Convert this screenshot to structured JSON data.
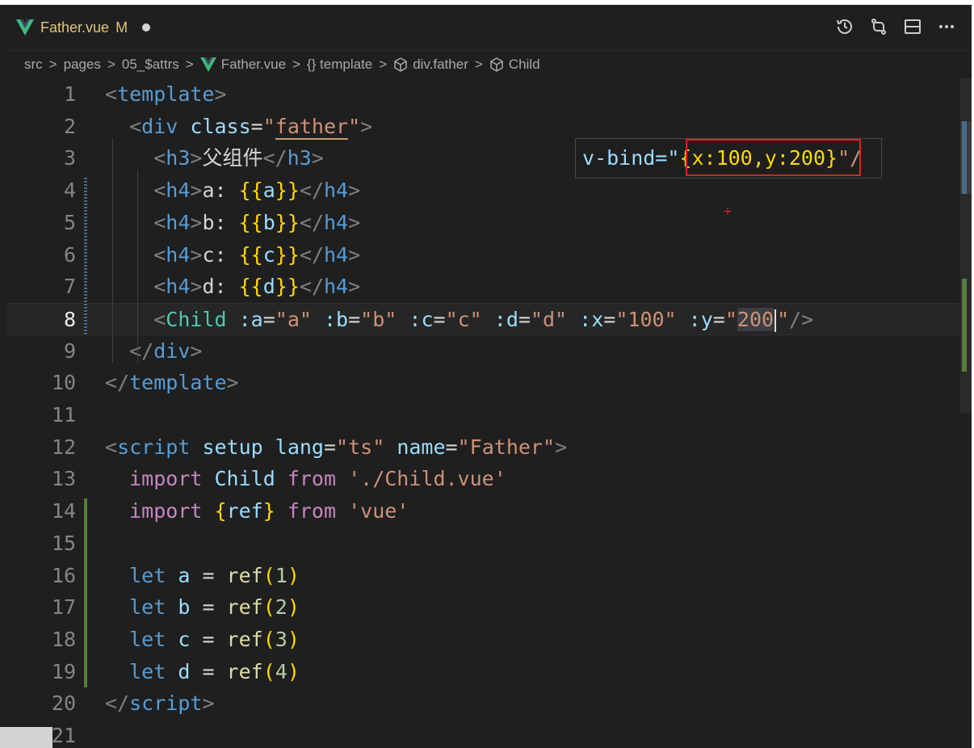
{
  "tab": {
    "title": "Father.vue",
    "status": "M"
  },
  "breadcrumb": [
    "src",
    "pages",
    "05_$attrs",
    "Father.vue",
    "{} template",
    "div.father",
    "Child"
  ],
  "hover": {
    "prefix": "v-bind=\"",
    "value": "{x:100,y:200}",
    "suffix": "\"/"
  },
  "lines": [
    {
      "n": "1",
      "tokens": [
        [
          "punc",
          "<"
        ],
        [
          "tag",
          "template"
        ],
        [
          "punc",
          ">"
        ]
      ]
    },
    {
      "n": "2",
      "tokens": [
        [
          "text",
          "  "
        ],
        [
          "punc",
          "<"
        ],
        [
          "tag",
          "div"
        ],
        [
          "text",
          " "
        ],
        [
          "attr",
          "class"
        ],
        [
          "text",
          "="
        ],
        [
          "str",
          "\""
        ],
        [
          "str",
          "father"
        ],
        [
          "str",
          "\""
        ],
        [
          "punc",
          ">"
        ]
      ]
    },
    {
      "n": "3",
      "tokens": [
        [
          "text",
          "    "
        ],
        [
          "punc",
          "<"
        ],
        [
          "tag",
          "h3"
        ],
        [
          "punc",
          ">"
        ],
        [
          "text",
          "父组件"
        ],
        [
          "punc",
          "</"
        ],
        [
          "tag",
          "h3"
        ],
        [
          "punc",
          ">"
        ]
      ]
    },
    {
      "n": "4",
      "tokens": [
        [
          "text",
          "    "
        ],
        [
          "punc",
          "<"
        ],
        [
          "tag",
          "h4"
        ],
        [
          "punc",
          ">"
        ],
        [
          "text",
          "a: "
        ],
        [
          "brace",
          "{{"
        ],
        [
          "var",
          "a"
        ],
        [
          "brace",
          "}}"
        ],
        [
          "punc",
          "</"
        ],
        [
          "tag",
          "h4"
        ],
        [
          "punc",
          ">"
        ]
      ]
    },
    {
      "n": "5",
      "tokens": [
        [
          "text",
          "    "
        ],
        [
          "punc",
          "<"
        ],
        [
          "tag",
          "h4"
        ],
        [
          "punc",
          ">"
        ],
        [
          "text",
          "b: "
        ],
        [
          "brace",
          "{{"
        ],
        [
          "var",
          "b"
        ],
        [
          "brace",
          "}}"
        ],
        [
          "punc",
          "</"
        ],
        [
          "tag",
          "h4"
        ],
        [
          "punc",
          ">"
        ]
      ]
    },
    {
      "n": "6",
      "tokens": [
        [
          "text",
          "    "
        ],
        [
          "punc",
          "<"
        ],
        [
          "tag",
          "h4"
        ],
        [
          "punc",
          ">"
        ],
        [
          "text",
          "c: "
        ],
        [
          "brace",
          "{{"
        ],
        [
          "var",
          "c"
        ],
        [
          "brace",
          "}}"
        ],
        [
          "punc",
          "</"
        ],
        [
          "tag",
          "h4"
        ],
        [
          "punc",
          ">"
        ]
      ]
    },
    {
      "n": "7",
      "tokens": [
        [
          "text",
          "    "
        ],
        [
          "punc",
          "<"
        ],
        [
          "tag",
          "h4"
        ],
        [
          "punc",
          ">"
        ],
        [
          "text",
          "d: "
        ],
        [
          "brace",
          "{{"
        ],
        [
          "var",
          "d"
        ],
        [
          "brace",
          "}}"
        ],
        [
          "punc",
          "</"
        ],
        [
          "tag",
          "h4"
        ],
        [
          "punc",
          ">"
        ]
      ]
    },
    {
      "n": "8",
      "tokens": [
        [
          "text",
          "    "
        ],
        [
          "punc",
          "<"
        ],
        [
          "comp",
          "Child"
        ],
        [
          "text",
          " "
        ],
        [
          "attr",
          ":a"
        ],
        [
          "text",
          "="
        ],
        [
          "str",
          "\"a\""
        ],
        [
          "text",
          " "
        ],
        [
          "attr",
          ":b"
        ],
        [
          "text",
          "="
        ],
        [
          "str",
          "\"b\""
        ],
        [
          "text",
          " "
        ],
        [
          "attr",
          ":c"
        ],
        [
          "text",
          "="
        ],
        [
          "str",
          "\"c\""
        ],
        [
          "text",
          " "
        ],
        [
          "attr",
          ":d"
        ],
        [
          "text",
          "="
        ],
        [
          "str",
          "\"d\""
        ],
        [
          "text",
          " "
        ],
        [
          "attr",
          ":x"
        ],
        [
          "text",
          "="
        ],
        [
          "str",
          "\"100\""
        ],
        [
          "text",
          " "
        ],
        [
          "attr",
          ":y"
        ],
        [
          "text",
          "="
        ],
        [
          "str",
          "\""
        ],
        [
          "sel",
          "200"
        ],
        [
          "cursor",
          ""
        ],
        [
          "str",
          "\""
        ],
        [
          "punc",
          "/>"
        ]
      ]
    },
    {
      "n": "9",
      "tokens": [
        [
          "text",
          "  "
        ],
        [
          "punc",
          "</"
        ],
        [
          "tag",
          "div"
        ],
        [
          "punc",
          ">"
        ]
      ]
    },
    {
      "n": "10",
      "tokens": [
        [
          "punc",
          "</"
        ],
        [
          "tag",
          "template"
        ],
        [
          "punc",
          ">"
        ]
      ]
    },
    {
      "n": "11",
      "tokens": []
    },
    {
      "n": "12",
      "tokens": [
        [
          "punc",
          "<"
        ],
        [
          "tag",
          "script"
        ],
        [
          "text",
          " "
        ],
        [
          "attr",
          "setup"
        ],
        [
          "text",
          " "
        ],
        [
          "attr",
          "lang"
        ],
        [
          "text",
          "="
        ],
        [
          "str",
          "\"ts\""
        ],
        [
          "text",
          " "
        ],
        [
          "attr",
          "name"
        ],
        [
          "text",
          "="
        ],
        [
          "str",
          "\"Father\""
        ],
        [
          "punc",
          ">"
        ]
      ]
    },
    {
      "n": "13",
      "tokens": [
        [
          "text",
          "  "
        ],
        [
          "kw",
          "import"
        ],
        [
          "text",
          " "
        ],
        [
          "var",
          "Child"
        ],
        [
          "text",
          " "
        ],
        [
          "kw",
          "from"
        ],
        [
          "text",
          " "
        ],
        [
          "str",
          "'./Child.vue'"
        ]
      ]
    },
    {
      "n": "14",
      "tokens": [
        [
          "text",
          "  "
        ],
        [
          "kw",
          "import"
        ],
        [
          "text",
          " "
        ],
        [
          "brace",
          "{"
        ],
        [
          "var",
          "ref"
        ],
        [
          "brace",
          "}"
        ],
        [
          "text",
          " "
        ],
        [
          "kw",
          "from"
        ],
        [
          "text",
          " "
        ],
        [
          "str",
          "'vue'"
        ]
      ]
    },
    {
      "n": "15",
      "tokens": []
    },
    {
      "n": "16",
      "tokens": [
        [
          "text",
          "  "
        ],
        [
          "decl",
          "let"
        ],
        [
          "text",
          " "
        ],
        [
          "var",
          "a"
        ],
        [
          "text",
          " = "
        ],
        [
          "fn",
          "ref"
        ],
        [
          "brace",
          "("
        ],
        [
          "num",
          "1"
        ],
        [
          "brace",
          ")"
        ]
      ]
    },
    {
      "n": "17",
      "tokens": [
        [
          "text",
          "  "
        ],
        [
          "decl",
          "let"
        ],
        [
          "text",
          " "
        ],
        [
          "var",
          "b"
        ],
        [
          "text",
          " = "
        ],
        [
          "fn",
          "ref"
        ],
        [
          "brace",
          "("
        ],
        [
          "num",
          "2"
        ],
        [
          "brace",
          ")"
        ]
      ]
    },
    {
      "n": "18",
      "tokens": [
        [
          "text",
          "  "
        ],
        [
          "decl",
          "let"
        ],
        [
          "text",
          " "
        ],
        [
          "var",
          "c"
        ],
        [
          "text",
          " = "
        ],
        [
          "fn",
          "ref"
        ],
        [
          "brace",
          "("
        ],
        [
          "num",
          "3"
        ],
        [
          "brace",
          ")"
        ]
      ]
    },
    {
      "n": "19",
      "tokens": [
        [
          "text",
          "  "
        ],
        [
          "decl",
          "let"
        ],
        [
          "text",
          " "
        ],
        [
          "var",
          "d"
        ],
        [
          "text",
          " = "
        ],
        [
          "fn",
          "ref"
        ],
        [
          "brace",
          "("
        ],
        [
          "num",
          "4"
        ],
        [
          "brace",
          ")"
        ]
      ]
    },
    {
      "n": "20",
      "tokens": [
        [
          "punc",
          "</"
        ],
        [
          "tag",
          "script"
        ],
        [
          "punc",
          ">"
        ]
      ]
    },
    {
      "n": "21",
      "tokens": []
    }
  ],
  "active_line": "8",
  "icons": [
    "vue-logo-icon",
    "timeline-icon",
    "compare-changes-icon",
    "split-editor-icon",
    "more-actions-icon",
    "chevron-right-icon",
    "cube-icon"
  ]
}
